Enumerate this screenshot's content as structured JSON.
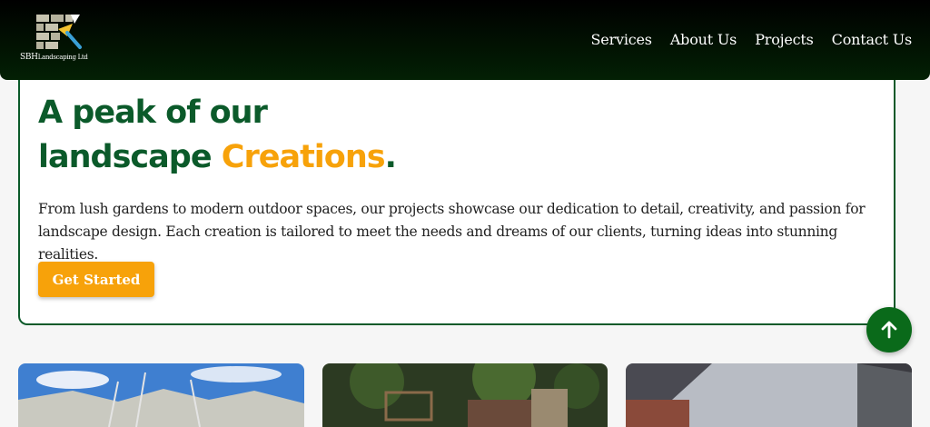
{
  "header": {
    "logo_text": "SBH",
    "logo_subtext": "Landscaping Ltd",
    "nav": [
      "Services",
      "About Us",
      "Projects",
      "Contact Us"
    ]
  },
  "hero": {
    "title_line1": "A peak of our",
    "title_line2_prefix": "landscape ",
    "title_accent": "Creations",
    "title_suffix": ".",
    "description": "From lush gardens to modern outdoor spaces, our projects showcase our dedication to detail, creativity, and passion for landscape design. Each creation is tailored to meet the needs and dreams of our clients, turning ideas into stunning realities.",
    "cta_label": "Get Started"
  },
  "colors": {
    "brand_green": "#0b5a2a",
    "accent_orange": "#f7a20a",
    "header_bg": "#032004",
    "scroll_button": "#0a6a1a"
  },
  "icons": {
    "logo": "brick-wall-trowel-icon",
    "scroll_top": "arrow-up-icon"
  }
}
